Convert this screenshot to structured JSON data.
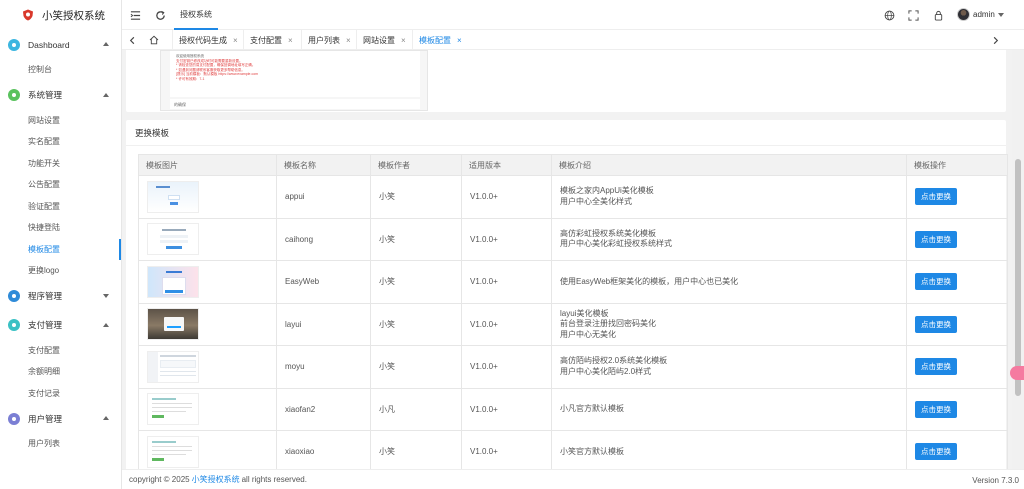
{
  "app": {
    "title": "小笑授权系统"
  },
  "sidebar": {
    "groups": [
      {
        "label": "Dashboard",
        "color": "#3db6e0",
        "open": true,
        "items": [
          {
            "label": "控制台"
          }
        ]
      },
      {
        "label": "系统管理",
        "color": "#5ac25e",
        "open": true,
        "items": [
          {
            "label": "网站设置"
          },
          {
            "label": "实名配置"
          },
          {
            "label": "功能开关"
          },
          {
            "label": "公告配置"
          },
          {
            "label": "验证配置"
          },
          {
            "label": "快捷登陆"
          },
          {
            "label": "模板配置",
            "active": true
          },
          {
            "label": "更换logo"
          }
        ]
      },
      {
        "label": "程序管理",
        "color": "#2f8bd8",
        "open": false,
        "items": []
      },
      {
        "label": "支付管理",
        "color": "#3bc1c4",
        "open": true,
        "items": [
          {
            "label": "支付配置"
          },
          {
            "label": "余额明细"
          },
          {
            "label": "支付记录"
          }
        ]
      },
      {
        "label": "用户管理",
        "color": "#7b7fd4",
        "open": true,
        "items": [
          {
            "label": "用户列表"
          }
        ]
      }
    ]
  },
  "header": {
    "tab": "授权系统",
    "user": "admin",
    "icons": [
      "menu-toggle-icon",
      "refresh-icon",
      "globe-icon",
      "fullscreen-icon",
      "lock-icon"
    ]
  },
  "tabs": {
    "items": [
      {
        "label": "授权代码生成"
      },
      {
        "label": "支付配置"
      },
      {
        "label": "用户列表"
      },
      {
        "label": "网站设置"
      },
      {
        "label": "模板配置",
        "active": true
      }
    ],
    "close_glyph": "×"
  },
  "preview": {
    "lines": [
      "欢迎使用授权系统",
      "支付密钥已修改成功时可能需要重新设置。",
      "* 请检查您的易支付配置，确保回调地址填写正确。",
      "* 如遇到问题请联系客服获取更多帮助信息。",
      "[提示] 当前模板：默认模板 https://www.example.com",
      "* 许可有效期：7-1"
    ],
    "ok_text": "的确保"
  },
  "template_section": {
    "title": "更换模板",
    "columns": [
      "模板图片",
      "模板名称",
      "模板作者",
      "适用版本",
      "模板介绍",
      "模板操作"
    ],
    "rows": [
      {
        "name": "appui",
        "author": "小笑",
        "version": "V1.0.0+",
        "desc": [
          "模板之家内AppUi美化模板",
          "用户中心全美化样式"
        ],
        "action": "点击更换",
        "thumb": "light-blue-form"
      },
      {
        "name": "caihong",
        "author": "小笑",
        "version": "V1.0.0+",
        "desc": [
          "高仿彩虹授权系统美化模板",
          "用户中心美化彩虹授权系统样式"
        ],
        "action": "点击更换",
        "thumb": "white-form"
      },
      {
        "name": "EasyWeb",
        "author": "小笑",
        "version": "V1.0.0+",
        "desc": [
          "使用EasyWeb框架美化的模板，用户中心也已美化"
        ],
        "action": "点击更换",
        "thumb": "blue-pink-gradient"
      },
      {
        "name": "layui",
        "author": "小笑",
        "version": "V1.0.0+",
        "desc": [
          "layui美化模板",
          "前台登录注册找回密码美化",
          "用户中心无美化"
        ],
        "action": "点击更换",
        "thumb": "dark-landscape"
      },
      {
        "name": "moyu",
        "author": "小笑",
        "version": "V1.0.0+",
        "desc": [
          "高仿陌屿授权2.0系统美化模板",
          "用户中心美化陌屿2.0样式"
        ],
        "action": "点击更换",
        "thumb": "admin-dashboard"
      },
      {
        "name": "xiaofan2",
        "author": "小凡",
        "version": "V1.0.0+",
        "desc": [
          "小凡官方默认模板"
        ],
        "action": "点击更换",
        "thumb": "text-page"
      },
      {
        "name": "xiaoxiao",
        "author": "小笑",
        "version": "V1.0.0+",
        "desc": [
          "小笑官方默认模板"
        ],
        "action": "点击更换",
        "thumb": "text-page"
      }
    ]
  },
  "footer": {
    "prefix": "copyright © 2025",
    "link": "小笑授权系统",
    "suffix": "all rights reserved.",
    "version": "Version 7.3.0"
  },
  "colors": {
    "accent": "#1e88e5",
    "float": "#f57aa0"
  }
}
